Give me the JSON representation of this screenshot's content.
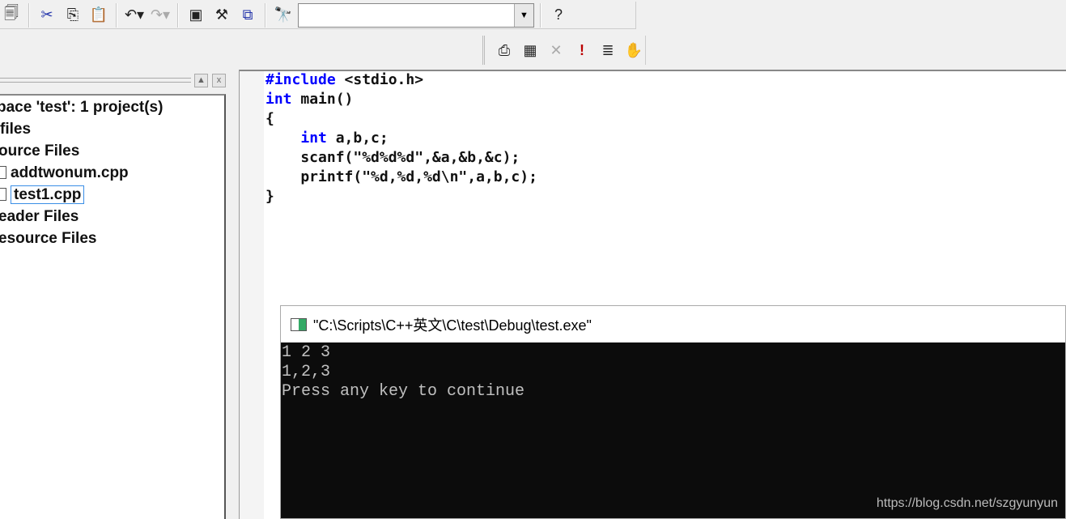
{
  "toolbar1": {
    "icons": [
      "save-all-icon",
      "cut-icon",
      "copy-icon",
      "paste-icon",
      "undo-icon",
      "redo-icon",
      "workspace-icon",
      "output-icon",
      "window-list-icon",
      "find-in-files-icon",
      "search-help-icon"
    ],
    "find_combo_value": ""
  },
  "toolbar2": {
    "icons": [
      "compile-icon",
      "build-icon",
      "stop-build-icon",
      "execute-icon",
      "go-icon",
      "breakpoint-hand-icon"
    ]
  },
  "workspace": {
    "items": [
      {
        "label": "pace 'test': 1 project(s)"
      },
      {
        "label": "files"
      },
      {
        "label": "ource Files"
      },
      {
        "label": "addtwonum.cpp"
      },
      {
        "label": "test1.cpp"
      },
      {
        "label": "eader Files"
      },
      {
        "label": "esource Files"
      }
    ]
  },
  "editor": {
    "lines": [
      {
        "kw": "#include",
        "rest": " <stdio.h>"
      },
      {
        "kw": "int",
        "rest": " main()"
      },
      {
        "kw": "",
        "rest": "{"
      },
      {
        "kw": "int",
        "rest": " a,b,c;",
        "indent": "    "
      },
      {
        "kw": "",
        "rest": "    scanf(\"%d%d%d\",&a,&b,&c);"
      },
      {
        "kw": "",
        "rest": "    printf(\"%d,%d,%d\\n\",a,b,c);"
      },
      {
        "kw": "",
        "rest": "}"
      }
    ]
  },
  "console": {
    "title": "\"C:\\Scripts\\C++英文\\C\\test\\Debug\\test.exe\"",
    "output": [
      "1 2 3",
      "1,2,3",
      "Press any key to continue"
    ]
  },
  "watermark": "https://blog.csdn.net/szgyunyun",
  "colors": {
    "keyword": "#0000ff",
    "console_bg": "#0c0c0c",
    "console_text": "#c0c0c0"
  }
}
